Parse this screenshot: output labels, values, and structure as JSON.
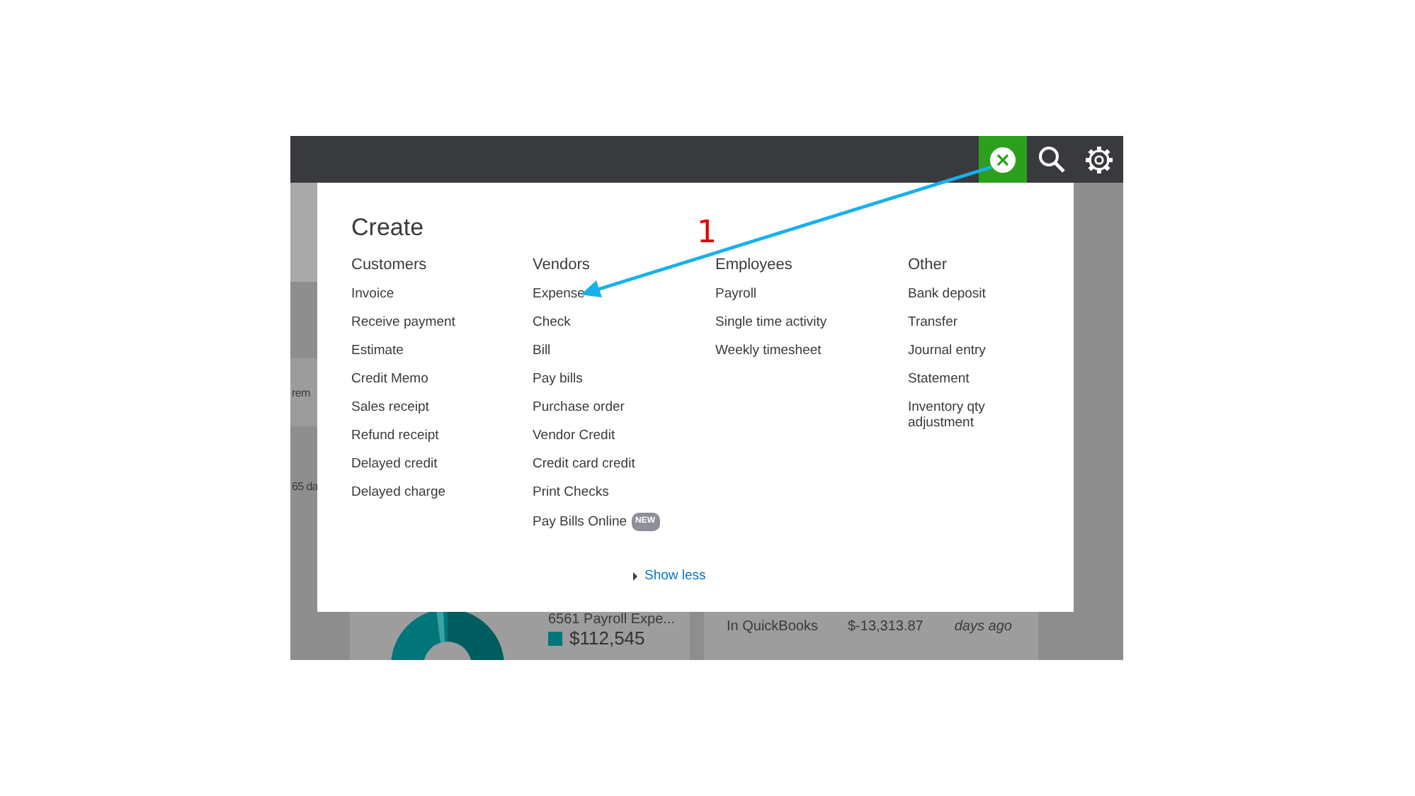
{
  "top_bar": {
    "create_expanded": true
  },
  "create_menu": {
    "title": "Create",
    "columns": [
      {
        "heading": "Customers",
        "items": [
          {
            "label": "Invoice"
          },
          {
            "label": "Receive payment"
          },
          {
            "label": "Estimate"
          },
          {
            "label": "Credit Memo"
          },
          {
            "label": "Sales receipt"
          },
          {
            "label": "Refund receipt"
          },
          {
            "label": "Delayed credit"
          },
          {
            "label": "Delayed charge"
          }
        ]
      },
      {
        "heading": "Vendors",
        "items": [
          {
            "label": "Expense"
          },
          {
            "label": "Check"
          },
          {
            "label": "Bill"
          },
          {
            "label": "Pay bills"
          },
          {
            "label": "Purchase order"
          },
          {
            "label": "Vendor Credit"
          },
          {
            "label": "Credit card credit"
          },
          {
            "label": "Print Checks"
          },
          {
            "label": "Pay Bills Online",
            "badge": "NEW"
          }
        ]
      },
      {
        "heading": "Employees",
        "items": [
          {
            "label": "Payroll"
          },
          {
            "label": "Single time activity"
          },
          {
            "label": "Weekly timesheet"
          }
        ]
      },
      {
        "heading": "Other",
        "items": [
          {
            "label": "Bank deposit"
          },
          {
            "label": "Transfer"
          },
          {
            "label": "Journal entry"
          },
          {
            "label": "Statement"
          },
          {
            "label": "Inventory qty adjustment"
          }
        ]
      }
    ],
    "show_less": "Show less"
  },
  "background": {
    "left_texts": [
      "rem",
      "65 da"
    ],
    "expense_card": {
      "label": "6561 Payroll Expe...",
      "amount": "$112,545"
    },
    "bank_card": {
      "label": "In QuickBooks",
      "amount": "$-13,313.87",
      "time": "days ago"
    }
  },
  "annotation": {
    "number": "1"
  }
}
